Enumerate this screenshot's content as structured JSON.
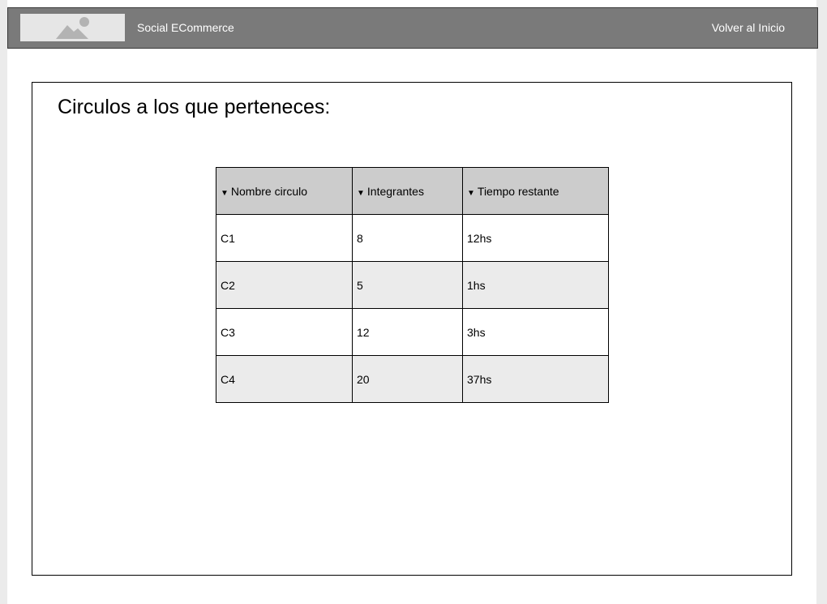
{
  "header": {
    "app_title": "Social ECommerce",
    "back_link": "Volver al Inicio",
    "logo_icon": "image-placeholder-icon"
  },
  "main": {
    "title": "Circulos a los que perteneces:",
    "table": {
      "columns": [
        {
          "label": "Nombre circulo",
          "icon": "sort-down-icon"
        },
        {
          "label": "Integrantes",
          "icon": "sort-down-icon"
        },
        {
          "label": "Tiempo restante",
          "icon": "sort-down-icon"
        }
      ],
      "rows": [
        [
          "C1",
          "8",
          "12hs"
        ],
        [
          "C2",
          "5",
          "1hs"
        ],
        [
          "C3",
          "12",
          "3hs"
        ],
        [
          "C4",
          "20",
          "37hs"
        ]
      ]
    }
  },
  "colors": {
    "header_bg": "#7a7a7a",
    "table_header_bg": "#cccccc",
    "row_alt_bg": "#ebebeb"
  }
}
